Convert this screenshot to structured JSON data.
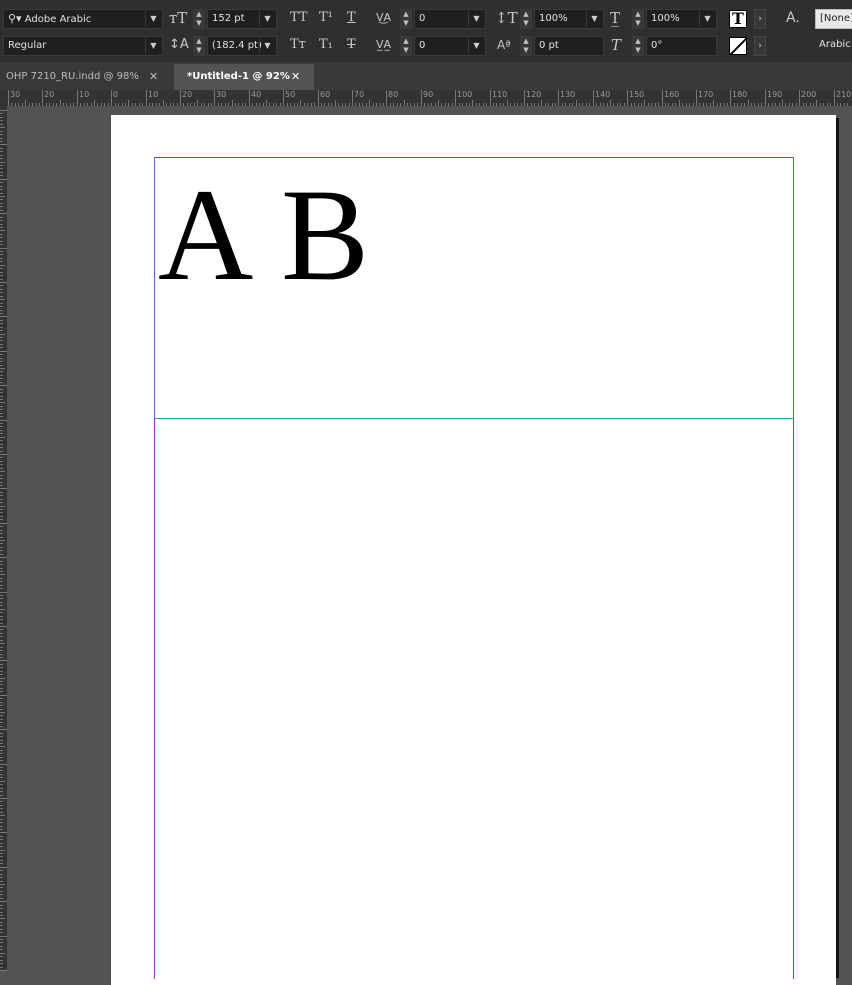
{
  "control_panel": {
    "font_family": "Adobe Arabic",
    "font_style": "Regular",
    "font_size": "152 pt",
    "leading": "(182.4 pt)",
    "kerning": "0",
    "tracking": "0",
    "vertical_scale": "100%",
    "horizontal_scale": "100%",
    "baseline_shift": "0 pt",
    "skew": "0°",
    "char_style": "[None]",
    "language": "Arabic",
    "caps_label": "TT",
    "superscript_label": "T¹",
    "underline_label": "T",
    "small_caps_label": "Tт",
    "subscript_label": "T₁",
    "strike_label": "T",
    "fill_icon_label": "T",
    "char_style_icon_label": "A."
  },
  "tabs": [
    {
      "label": "OHP 7210_RU.indd @ 98%",
      "active": false
    },
    {
      "label": "*Untitled-1 @ 92%",
      "active": true
    }
  ],
  "ruler": {
    "labels": [
      "30",
      "20",
      "10",
      "0",
      "10",
      "20",
      "30",
      "40",
      "50",
      "60",
      "70",
      "80",
      "90",
      "100",
      "110",
      "120",
      "130",
      "140",
      "150",
      "160",
      "170",
      "180",
      "190",
      "200",
      "210"
    ]
  },
  "document": {
    "text": "A B"
  },
  "colors": {
    "frame_blue": "#4a6cff",
    "margin_magenta": "#a12bd9",
    "guide_cyan": "#2aa5a0"
  }
}
